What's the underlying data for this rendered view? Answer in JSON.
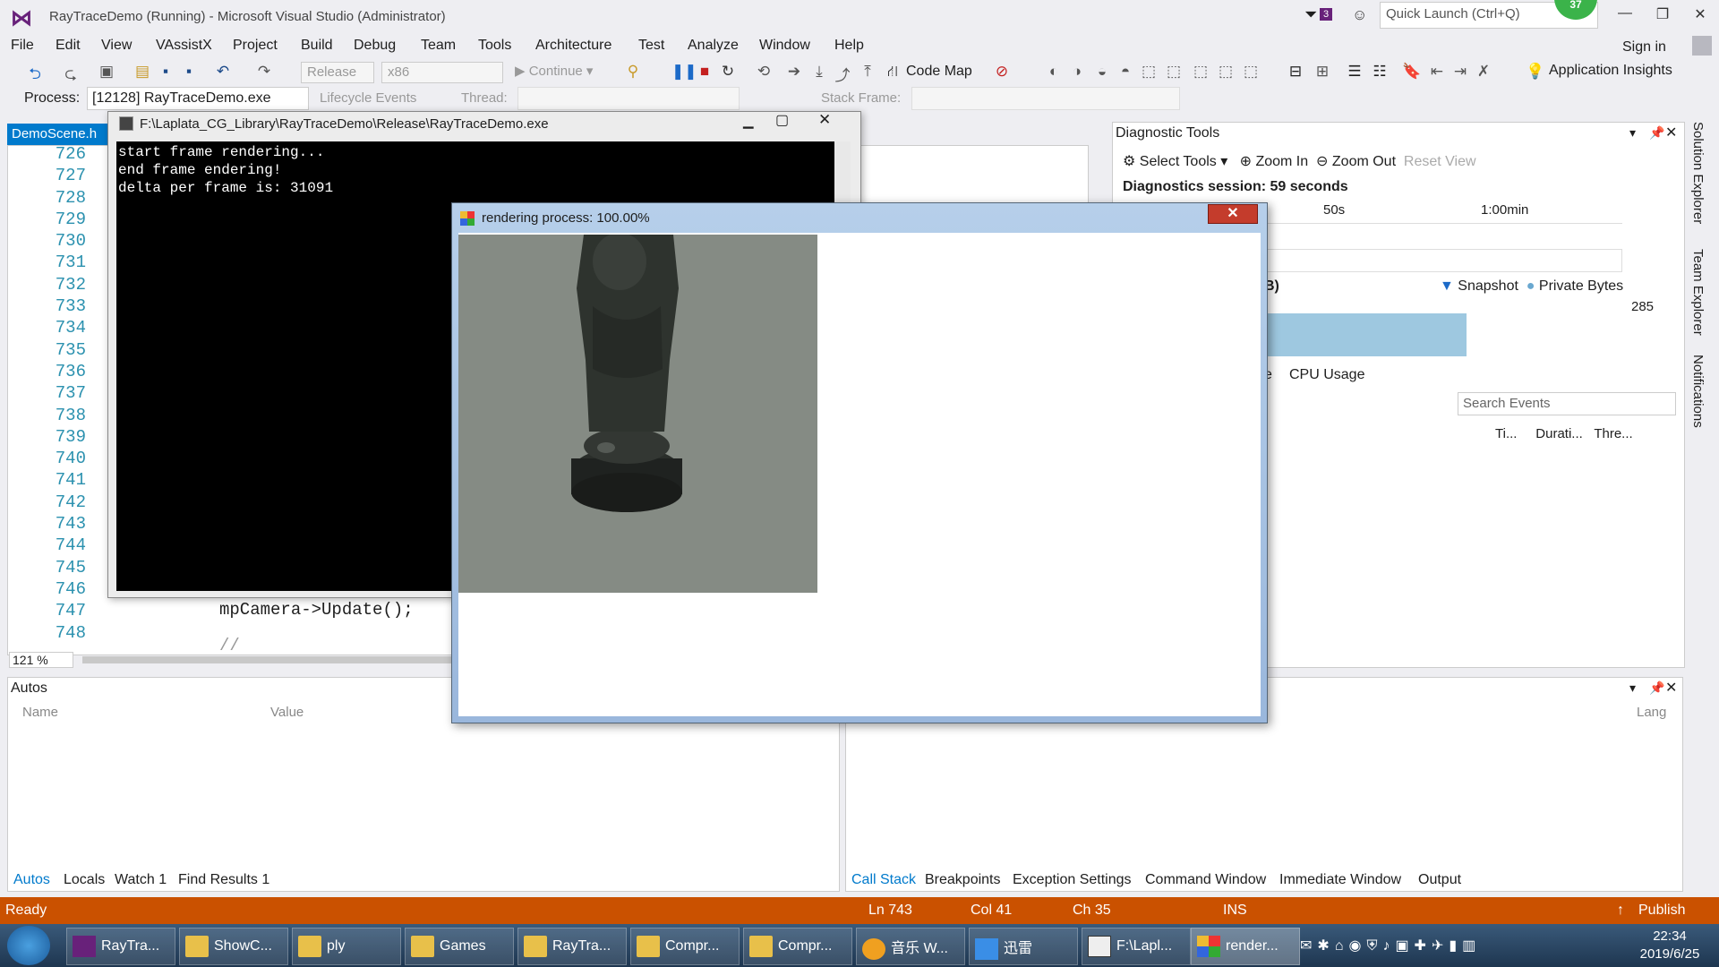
{
  "window": {
    "title": "RayTraceDemo (Running) - Microsoft Visual Studio (Administrator)",
    "notification_count": "3",
    "quick_launch_placeholder": "Quick Launch (Ctrl+Q)",
    "badge_value": "37",
    "sign_in": "Sign in"
  },
  "menu": [
    "File",
    "Edit",
    "View",
    "VAssistX",
    "Project",
    "Build",
    "Debug",
    "Team",
    "Tools",
    "Architecture",
    "Test",
    "Analyze",
    "Window",
    "Help"
  ],
  "toolbar": {
    "config": "Release",
    "platform": "x86",
    "continue": "Continue",
    "code_map": "Code Map",
    "app_insights": "Application Insights"
  },
  "debug_bar": {
    "process_label": "Process:",
    "process_value": "[12128] RayTraceDemo.exe",
    "lifecycle": "Lifecycle Events",
    "thread_label": "Thread:",
    "stack_frame_label": "Stack Frame:"
  },
  "editor": {
    "tab": "DemoScene.h",
    "line_numbers": [
      "726",
      "727",
      "728",
      "729",
      "730",
      "731",
      "732",
      "733",
      "734",
      "735",
      "736",
      "737",
      "738",
      "739",
      "740",
      "741",
      "742",
      "743",
      "744",
      "745",
      "746",
      "747",
      "748"
    ],
    "code_visible": "mpCamera->Update();",
    "code_visible2": "//",
    "zoom": "121 %"
  },
  "console": {
    "title": "F:\\Laplata_CG_Library\\RayTraceDemo\\Release\\RayTraceDemo.exe",
    "output": "start frame rendering...\nend frame endering!\ndelta per frame is: 31091"
  },
  "render_window": {
    "title": "rendering process: 100.00%"
  },
  "diagnostics": {
    "title": "Diagnostic Tools",
    "select_tools": "Select Tools",
    "zoom_in": "Zoom In",
    "zoom_out": "Zoom Out",
    "reset_view": "Reset View",
    "session": "Diagnostics session: 59 seconds",
    "tick_50": "50s",
    "tick_60": "1:00min",
    "mem_unit_fragment": "B)",
    "legend_snapshot": "Snapshot",
    "legend_private": "Private Bytes",
    "mem_value": "285",
    "tab_fragment": "e",
    "cpu_tab": "CPU Usage",
    "search_placeholder": "Search Events",
    "col_ti": "Ti...",
    "col_dur": "Durati...",
    "col_thr": "Thre..."
  },
  "right_dock": [
    "Solution Explorer",
    "Team Explorer",
    "Notifications"
  ],
  "autos": {
    "title": "Autos",
    "col_name": "Name",
    "col_value": "Value",
    "col_lang": "Lang",
    "tabs": [
      "Autos",
      "Locals",
      "Watch 1",
      "Find Results 1"
    ]
  },
  "callstack_tabs": [
    "Call Stack",
    "Breakpoints",
    "Exception Settings",
    "Command Window",
    "Immediate Window",
    "Output"
  ],
  "status": {
    "state": "Ready",
    "ln": "Ln 743",
    "col": "Col 41",
    "ch": "Ch 35",
    "ins": "INS",
    "publish": "Publish"
  },
  "taskbar": {
    "items": [
      "RayTra...",
      "ShowC...",
      "ply",
      "Games",
      "RayTra...",
      "Compr...",
      "Compr...",
      "音乐 W...",
      "迅雷",
      "F:\\Lapl...",
      "render..."
    ],
    "time": "22:34",
    "date": "2019/6/25"
  },
  "colors": {
    "accent": "#007acc",
    "status_bar": "#ca5100",
    "vs_purple": "#68217a",
    "render_bg": "#858b84"
  }
}
